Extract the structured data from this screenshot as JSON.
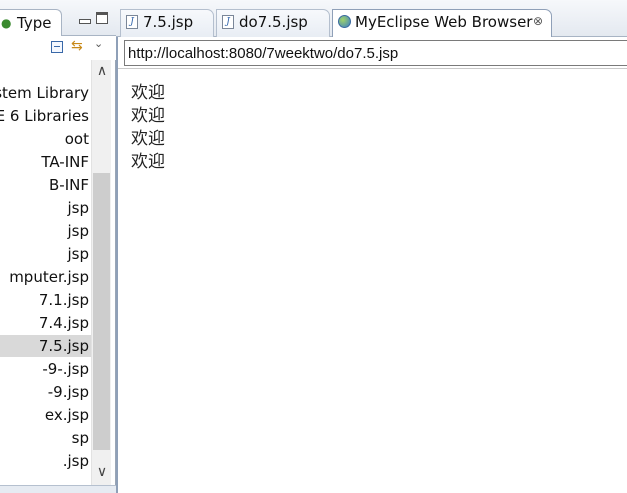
{
  "left_panel": {
    "tab_label": "Type",
    "tree_items": [
      {
        "label": "stem Library"
      },
      {
        "label": "E 6 Libraries"
      },
      {
        "label": "oot"
      },
      {
        "label": "TA-INF"
      },
      {
        "label": "B-INF"
      },
      {
        "label": "jsp"
      },
      {
        "label": "jsp"
      },
      {
        "label": "jsp"
      },
      {
        "label": "mputer.jsp"
      },
      {
        "label": "7.1.jsp"
      },
      {
        "label": "7.4.jsp"
      },
      {
        "label": "7.5.jsp",
        "selected": true
      },
      {
        "label": "-9-.jsp"
      },
      {
        "label": "-9.jsp"
      },
      {
        "label": "ex.jsp"
      },
      {
        "label": "sp"
      },
      {
        "label": ".jsp"
      }
    ]
  },
  "editor": {
    "tabs": [
      {
        "label": "7.5.jsp",
        "icon": "jsp-file-icon"
      },
      {
        "label": "do7.5.jsp",
        "icon": "jsp-file-icon"
      },
      {
        "label": "MyEclipse Web Browser",
        "icon": "globe-icon",
        "active": true
      }
    ],
    "browser": {
      "url": "http://localhost:8080/7weektwo/do7.5.jsp",
      "content_lines": [
        "欢迎",
        "欢迎",
        "欢迎",
        "欢迎"
      ]
    }
  },
  "colors": {
    "tab_border": "#a8b4c4",
    "selected_item": "#d9d9d9",
    "scroll_thumb": "#cdcdcd"
  }
}
